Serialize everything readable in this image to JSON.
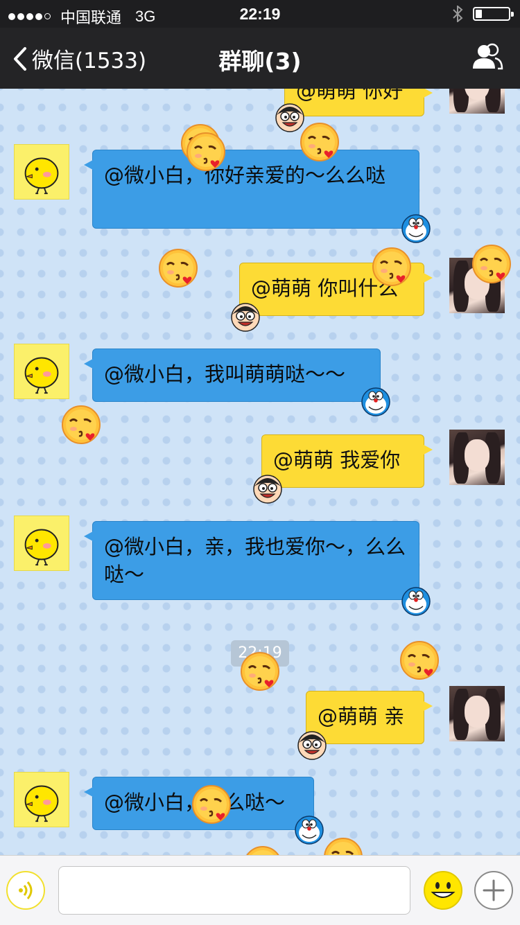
{
  "status_bar": {
    "carrier": "中国联通",
    "network": "3G",
    "time": "22:19"
  },
  "nav": {
    "back_label": "微信(1533)",
    "title": "群聊(3)"
  },
  "messages": [
    {
      "side": "right",
      "text": "@萌萌 你好"
    },
    {
      "side": "left",
      "text": "@微小白，你好亲爱的～么么哒"
    },
    {
      "side": "right",
      "text": "@萌萌 你叫什么"
    },
    {
      "side": "left",
      "text": "@微小白，我叫萌萌哒～～"
    },
    {
      "side": "right",
      "text": "@萌萌 我爱你"
    },
    {
      "side": "left",
      "text": "@微小白，亲，我也爱你～，么么哒～"
    },
    {
      "side": "right",
      "text": "@萌萌 亲"
    },
    {
      "side": "left",
      "text": "@微小白，么么哒～"
    }
  ],
  "timestamp": "22:19",
  "input": {
    "placeholder": ""
  },
  "colors": {
    "nav_bg": "#242426",
    "chat_bg": "#cfe3f7",
    "left_bubble": "#3c9de6",
    "right_bubble": "#fddb35"
  },
  "icons": [
    "back-chevron-icon",
    "group-members-icon",
    "voice-icon",
    "emoji-icon",
    "plus-icon",
    "bluetooth-icon",
    "battery-icon"
  ]
}
